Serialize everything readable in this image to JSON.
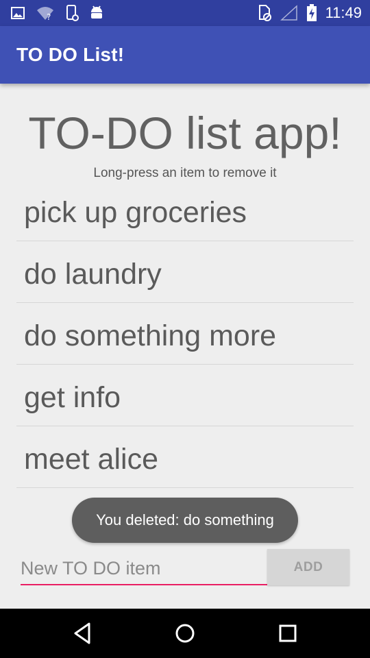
{
  "status_bar": {
    "time": "11:49",
    "left_icons": [
      "image-icon",
      "wifi-question-icon",
      "phone-sync-icon",
      "android-icon"
    ],
    "right_icons": [
      "sim-card-off-icon",
      "cell-signal-icon",
      "battery-charging-icon"
    ]
  },
  "app_bar": {
    "title": "TO DO List!"
  },
  "main": {
    "heading": "TO-DO list app!",
    "subtitle": "Long-press an item to remove it",
    "items": [
      {
        "label": "pick up groceries"
      },
      {
        "label": "do laundry"
      },
      {
        "label": "do something more"
      },
      {
        "label": "get info"
      },
      {
        "label": "meet alice"
      }
    ]
  },
  "toast": {
    "message": "You deleted: do something"
  },
  "input_bar": {
    "placeholder": "New TO DO item",
    "value": "",
    "add_label": "ADD"
  },
  "nav_bar": {
    "buttons": [
      "back-icon",
      "home-icon",
      "recents-icon"
    ]
  },
  "colors": {
    "status_bar": "#303f9f",
    "app_bar": "#3f51b5",
    "accent": "#e91e63",
    "background": "#eeeeee"
  }
}
